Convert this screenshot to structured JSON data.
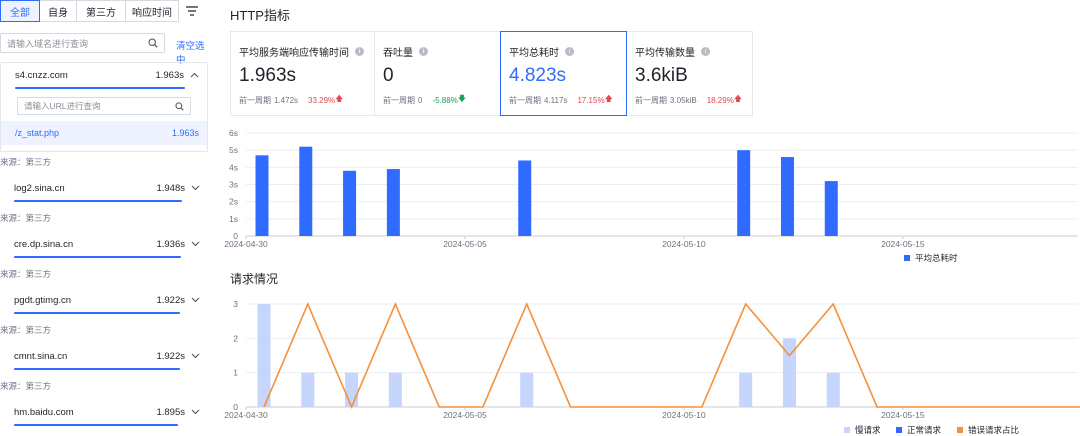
{
  "filters": {
    "tabs": [
      {
        "label": "全部",
        "active": true
      },
      {
        "label": "自身",
        "active": false
      },
      {
        "label": "第三方",
        "active": false
      },
      {
        "label": "响应时间",
        "active": false
      }
    ],
    "filter_icon": "filter-lines-icon"
  },
  "search": {
    "placeholder": "请输入域名进行查询",
    "clear_label": "清空选中"
  },
  "domains": [
    {
      "name": "s4.cnzz.com",
      "time": "1.963s",
      "expanded": true,
      "source": "来源：第三方"
    },
    {
      "name": "log2.sina.cn",
      "time": "1.948s",
      "expanded": false,
      "source": "来源：第三方"
    },
    {
      "name": "cre.dp.sina.cn",
      "time": "1.936s",
      "expanded": false,
      "source": "来源：第三方"
    },
    {
      "name": "pgdt.gtimg.cn",
      "time": "1.922s",
      "expanded": false,
      "source": "来源：第三方"
    },
    {
      "name": "cmnt.sina.cn",
      "time": "1.922s",
      "expanded": false,
      "source": "来源：第三方"
    },
    {
      "name": "hm.baidu.com",
      "time": "1.895s",
      "expanded": false,
      "source": ""
    }
  ],
  "url_search": {
    "placeholder": "请输入URL进行查询"
  },
  "url_item": {
    "name": "/z_stat.php",
    "time": "1.963s"
  },
  "page_title": "HTTP指标",
  "metrics": [
    {
      "label": "平均服务端响应传输时间",
      "value": "1.963s",
      "prev_label": "前一周期",
      "prev_value": "1.472s",
      "change": "33.29%",
      "direction": "up",
      "selected": false
    },
    {
      "label": "吞吐量",
      "value": "0",
      "prev_label": "前一周期",
      "prev_value": "0",
      "change": "-5.88%",
      "direction": "down",
      "selected": false
    },
    {
      "label": "平均总耗时",
      "value": "4.823s",
      "prev_label": "前一周期",
      "prev_value": "4.117s",
      "change": "17.15%",
      "direction": "up",
      "selected": true
    },
    {
      "label": "平均传输数量",
      "value": "3.6kiB",
      "prev_label": "前一周期",
      "prev_value": "3.05kiB",
      "change": "18.29%",
      "direction": "up",
      "selected": false
    }
  ],
  "colors": {
    "accent": "#2f6bff",
    "up": "#e5484d",
    "down": "#18a058",
    "slow": "#c5d5fb",
    "normal": "#2f6bff",
    "error_line": "#f5913b"
  },
  "chart_data": [
    {
      "type": "bar",
      "x_ticks": [
        "2024-04-30",
        "2024-05-05",
        "2024-05-10",
        "2024-05-15"
      ],
      "y_ticks": [
        "0",
        "1s",
        "2s",
        "3s",
        "4s",
        "5s",
        "6s"
      ],
      "ylim": [
        0,
        6
      ],
      "x_range": [
        "2024-04-30",
        "2024-05-19"
      ],
      "series": [
        {
          "name": "平均总耗时",
          "color": "#2f6bff",
          "points": [
            {
              "x": "2024-04-30",
              "y": 4.7
            },
            {
              "x": "2024-05-01",
              "y": 5.2
            },
            {
              "x": "2024-05-02",
              "y": 3.8
            },
            {
              "x": "2024-05-03",
              "y": 3.9
            },
            {
              "x": "2024-05-06",
              "y": 4.4
            },
            {
              "x": "2024-05-11",
              "y": 5.0
            },
            {
              "x": "2024-05-12",
              "y": 4.6
            },
            {
              "x": "2024-05-13",
              "y": 3.2
            }
          ]
        }
      ],
      "legend_position": "bottom-right"
    },
    {
      "type": "bar",
      "title": "请求情况",
      "x_ticks": [
        "2024-04-30",
        "2024-05-05",
        "2024-05-10",
        "2024-05-15"
      ],
      "y_ticks": [
        "0",
        "1",
        "2",
        "3"
      ],
      "ylim": [
        0,
        3
      ],
      "x_range": [
        "2024-04-30",
        "2024-05-19"
      ],
      "series": [
        {
          "name": "慢请求",
          "kind": "bar",
          "color": "#c5d5fb",
          "points": [
            {
              "x": "2024-04-30",
              "y": 3
            },
            {
              "x": "2024-05-01",
              "y": 1
            },
            {
              "x": "2024-05-02",
              "y": 1
            },
            {
              "x": "2024-05-03",
              "y": 1
            },
            {
              "x": "2024-05-06",
              "y": 1
            },
            {
              "x": "2024-05-11",
              "y": 1
            },
            {
              "x": "2024-05-12",
              "y": 2
            },
            {
              "x": "2024-05-13",
              "y": 1
            }
          ]
        },
        {
          "name": "正常请求",
          "kind": "bar",
          "color": "#2f6bff",
          "points": []
        },
        {
          "name": "错误请求占比",
          "kind": "line",
          "color": "#f5913b",
          "points": [
            {
              "x": "2024-04-30",
              "y": 0
            },
            {
              "x": "2024-05-01",
              "y": 3
            },
            {
              "x": "2024-05-02",
              "y": 0
            },
            {
              "x": "2024-05-03",
              "y": 3
            },
            {
              "x": "2024-05-04",
              "y": 0
            },
            {
              "x": "2024-05-05",
              "y": 0
            },
            {
              "x": "2024-05-06",
              "y": 3
            },
            {
              "x": "2024-05-07",
              "y": 0
            },
            {
              "x": "2024-05-10",
              "y": 0
            },
            {
              "x": "2024-05-11",
              "y": 3
            },
            {
              "x": "2024-05-12",
              "y": 1.5
            },
            {
              "x": "2024-05-13",
              "y": 3
            },
            {
              "x": "2024-05-14",
              "y": 0
            },
            {
              "x": "2024-05-19",
              "y": 0
            }
          ]
        }
      ],
      "legend_position": "bottom-right"
    }
  ]
}
